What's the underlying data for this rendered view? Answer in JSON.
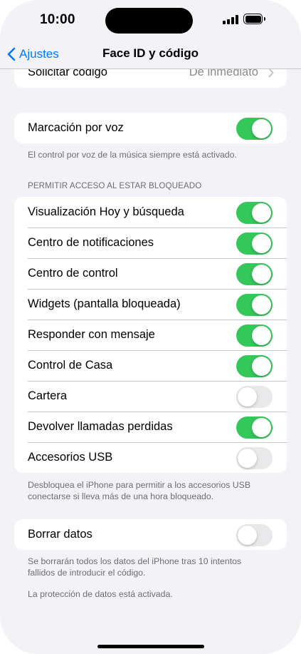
{
  "status_bar": {
    "time": "10:00"
  },
  "nav": {
    "back_label": "Ajustes",
    "title": "Face ID y código"
  },
  "require_passcode": {
    "label": "Solicitar código",
    "value": "De inmediato"
  },
  "voice_dial": {
    "label": "Marcación por voz",
    "on": true,
    "footer": "El control por voz de la música siempre está activado."
  },
  "lock_access": {
    "header": "PERMITIR ACCESO AL ESTAR BLOQUEADO",
    "items": [
      {
        "label": "Visualización Hoy y búsqueda",
        "on": true
      },
      {
        "label": "Centro de notificaciones",
        "on": true
      },
      {
        "label": "Centro de control",
        "on": true
      },
      {
        "label": "Widgets (pantalla bloqueada)",
        "on": true
      },
      {
        "label": "Responder con mensaje",
        "on": true
      },
      {
        "label": "Control de Casa",
        "on": true
      },
      {
        "label": "Cartera",
        "on": false
      },
      {
        "label": "Devolver llamadas perdidas",
        "on": true
      },
      {
        "label": "Accesorios USB",
        "on": false
      }
    ],
    "footer_line1": "Desbloquea el iPhone para permitir a los accesorios USB",
    "footer_line2": "conectarse si lleva más de una hora bloqueado."
  },
  "erase_data": {
    "label": "Borrar datos",
    "on": false,
    "footer_line1": "Se borrarán todos los datos del iPhone tras 10 intentos",
    "footer_line2": "fallidos de introducir el código.",
    "protection_note": "La protección de datos está activada."
  },
  "colors": {
    "accent": "#007aff",
    "toggle_on": "#34c759",
    "toggle_off": "#e9e9eb",
    "background": "#f2f2f7"
  }
}
